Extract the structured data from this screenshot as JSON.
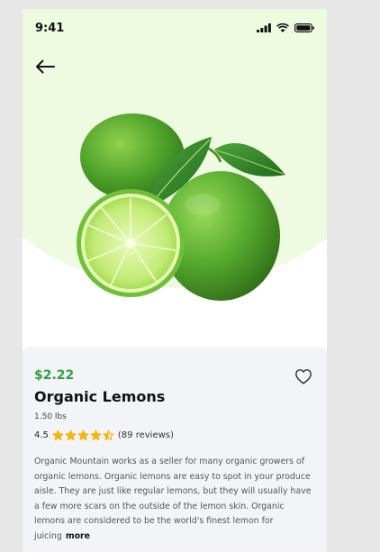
{
  "status_bar": {
    "time": "9:41"
  },
  "product": {
    "price": "$2.22",
    "name": "Organic Lemons",
    "weight": "1.50 lbs",
    "rating": "4.5",
    "rating_value": 4.5,
    "rating_max": 5,
    "reviews": "(89 reviews)",
    "description": "Organic Mountain works as a seller for many organic growers of organic lemons. Organic lemons are easy to spot in your produce aisle. They are just like regular lemons, but they will usually have a few more scars on the outside of the lemon skin. Organic lemons are considered to be the world's finest lemon for juicing",
    "more_label": "more"
  },
  "colors": {
    "price_green": "#2ba23c",
    "star_gold": "#f5b50a",
    "hero_bg": "#eefbe1",
    "card_bg": "#f3f4f8"
  },
  "icons": {
    "back": "arrow-left-icon",
    "favorite": "heart-outline-icon",
    "signal": "cellular-signal-icon",
    "wifi": "wifi-icon",
    "battery": "battery-icon"
  }
}
